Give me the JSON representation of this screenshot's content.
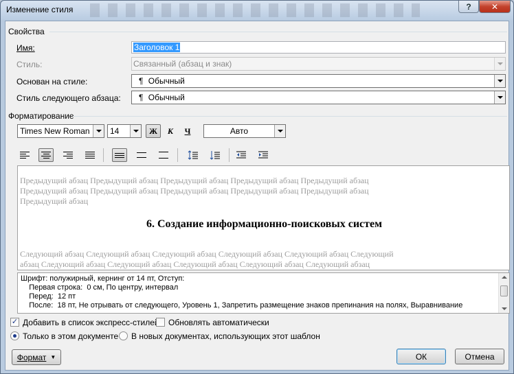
{
  "window": {
    "title": "Изменение стиля",
    "help_label": "?",
    "close_label": "✕"
  },
  "properties": {
    "section_label": "Свойства",
    "name_label": "Имя:",
    "name_value": "Заголовок 1",
    "style_type_label": "Стиль:",
    "style_type_value": "Связанный (абзац и знак)",
    "based_on_label": "Основан на стиле:",
    "based_on_value": "Обычный",
    "next_para_label": "Стиль следующего абзаца:",
    "next_para_value": "Обычный",
    "para_glyph": "¶"
  },
  "formatting": {
    "section_label": "Форматирование",
    "font_name": "Times New Roman",
    "font_size": "14",
    "bold_label": "Ж",
    "italic_label": "К",
    "underline_label": "Ч",
    "color_value": "Авто"
  },
  "preview": {
    "prev_line1": "Предыдущий абзац Предыдущий абзац Предыдущий абзац Предыдущий абзац Предыдущий абзац",
    "prev_line2": "Предыдущий абзац Предыдущий абзац Предыдущий абзац Предыдущий абзац Предыдущий абзац",
    "prev_line3": "Предыдущий абзац",
    "heading": "6. Создание информационно-поисковых систем",
    "next_line1": "Следующий абзац Следующий абзац Следующий абзац Следующий абзац Следующий абзац Следующий",
    "next_line2": "абзац Следующий абзац Следующий абзац Следующий абзац Следующий абзац Следующий абзац"
  },
  "description": {
    "line1": "Шрифт: полужирный, кернинг от 14 пт, Отступ:",
    "line2": "    Первая строка:  0 см, По центру, интервал",
    "line3": "    Перед:  12 пт",
    "line4": "    После:  18 пт, Не отрывать от следующего, Уровень 1, Запретить размещение знаков препинания на полях, Выравнивание"
  },
  "options": {
    "add_quick_label": "Добавить в список экспресс-стилей",
    "add_quick_checked": true,
    "auto_update_label": "Обновлять автоматически",
    "auto_update_checked": false,
    "only_doc_label": "Только в этом документе",
    "new_docs_label": "В новых документах, использующих этот шаблон",
    "check_glyph": "✓"
  },
  "buttons": {
    "format_label": "Формат",
    "ok_label": "ОК",
    "cancel_label": "Отмена"
  }
}
